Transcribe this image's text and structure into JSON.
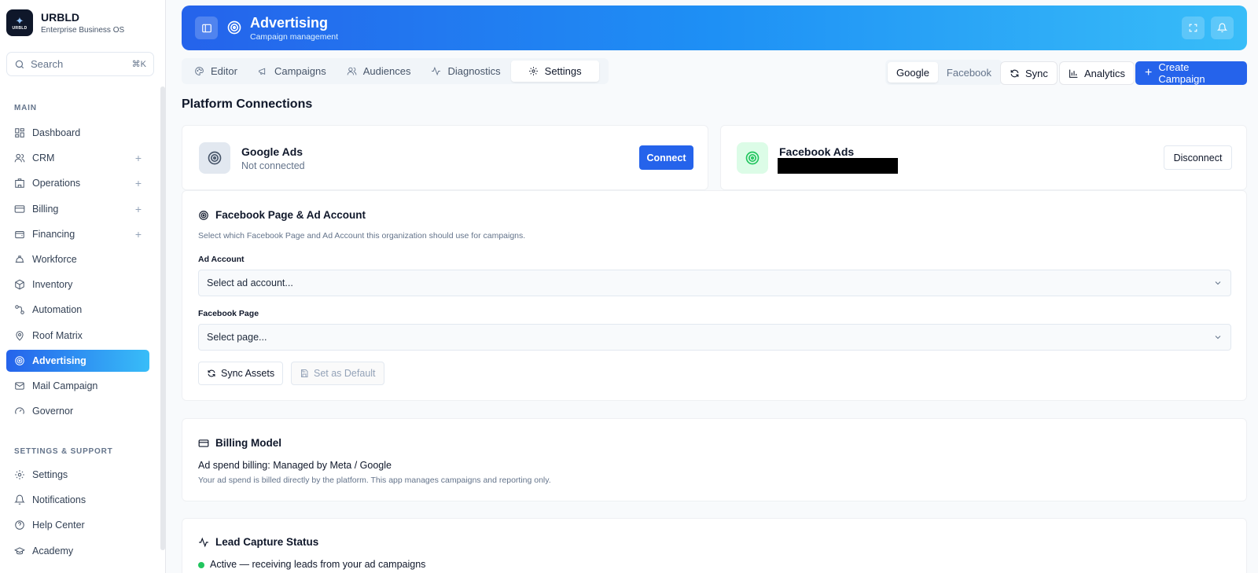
{
  "brand": {
    "logo_text": "URBLD",
    "name": "URBLD",
    "subtitle": "Enterprise Business OS"
  },
  "search": {
    "placeholder": "Search",
    "shortcut": "⌘K"
  },
  "sidebar": {
    "main_label": "MAIN",
    "items": [
      {
        "label": "Dashboard",
        "icon": "dashboard-icon",
        "expandable": false
      },
      {
        "label": "CRM",
        "icon": "users-icon",
        "expandable": true
      },
      {
        "label": "Operations",
        "icon": "building-icon",
        "expandable": true
      },
      {
        "label": "Billing",
        "icon": "credit-card-icon",
        "expandable": true
      },
      {
        "label": "Financing",
        "icon": "wallet-icon",
        "expandable": true
      },
      {
        "label": "Workforce",
        "icon": "hard-hat-icon",
        "expandable": false
      },
      {
        "label": "Inventory",
        "icon": "package-icon",
        "expandable": false
      },
      {
        "label": "Automation",
        "icon": "workflow-icon",
        "expandable": false
      },
      {
        "label": "Roof Matrix",
        "icon": "map-pin-icon",
        "expandable": false
      },
      {
        "label": "Advertising",
        "icon": "target-icon",
        "expandable": false,
        "active": true
      },
      {
        "label": "Mail Campaign",
        "icon": "mail-icon",
        "expandable": false
      },
      {
        "label": "Governor",
        "icon": "gauge-icon",
        "expandable": false
      }
    ],
    "support_label": "SETTINGS & SUPPORT",
    "support_items": [
      {
        "label": "Settings",
        "icon": "gear-icon"
      },
      {
        "label": "Notifications",
        "icon": "bell-icon"
      },
      {
        "label": "Help Center",
        "icon": "help-circle-icon"
      },
      {
        "label": "Academy",
        "icon": "graduation-cap-icon"
      }
    ]
  },
  "header": {
    "title": "Advertising",
    "subtitle": "Campaign management"
  },
  "tabs": [
    {
      "label": "Editor",
      "icon": "palette-icon"
    },
    {
      "label": "Campaigns",
      "icon": "megaphone-icon"
    },
    {
      "label": "Audiences",
      "icon": "users-icon"
    },
    {
      "label": "Diagnostics",
      "icon": "activity-icon"
    },
    {
      "label": "Settings",
      "icon": "gear-icon",
      "active": true
    }
  ],
  "platform_toggle": {
    "google": "Google",
    "facebook": "Facebook",
    "selected": "Google"
  },
  "actions": {
    "sync": "Sync",
    "analytics": "Analytics",
    "create": "Create Campaign"
  },
  "page_title": "Platform Connections",
  "google_card": {
    "title": "Google Ads",
    "status": "Not connected",
    "button": "Connect"
  },
  "facebook_card": {
    "title": "Facebook Ads",
    "button": "Disconnect"
  },
  "fb_assets": {
    "title": "Facebook Page & Ad Account",
    "description": "Select which Facebook Page and Ad Account this organization should use for campaigns.",
    "ad_account_label": "Ad Account",
    "ad_account_value": "Select ad account...",
    "page_label": "Facebook Page",
    "page_value": "Select page...",
    "sync_button": "Sync Assets",
    "default_button": "Set as Default"
  },
  "billing": {
    "title": "Billing Model",
    "headline": "Ad spend billing: Managed by Meta / Google",
    "description": "Your ad spend is billed directly by the platform. This app manages campaigns and reporting only."
  },
  "lead_capture": {
    "title": "Lead Capture Status",
    "status": "Active — receiving leads from your ad campaigns"
  },
  "colors": {
    "accent": "#2563eb",
    "gradient_end": "#38bdf8",
    "success": "#22c55e",
    "facebook_green": "#22c55e"
  }
}
